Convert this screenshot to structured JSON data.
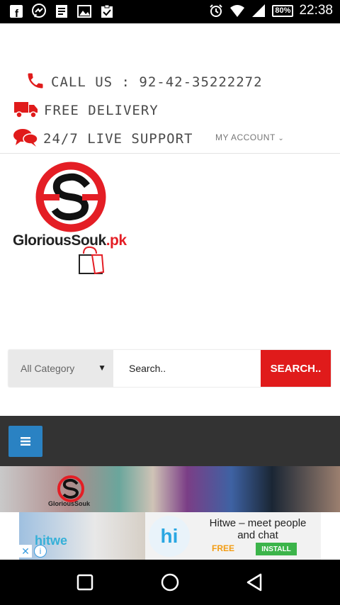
{
  "status_bar": {
    "time": "22:38",
    "battery": "80%",
    "notification_icons": [
      "facebook-icon",
      "messenger-icon",
      "document-icon",
      "image-icon",
      "clipboard-check-icon"
    ],
    "system_icons": [
      "alarm-icon",
      "wifi-icon",
      "signal-icon",
      "battery-icon"
    ]
  },
  "header": {
    "call_us": "CALL US : 92-42-35222272",
    "free_delivery": "FREE DELIVERY",
    "live_support": "24/7 LIVE SUPPORT",
    "my_account": "MY ACCOUNT"
  },
  "logo": {
    "text_main": "GloriousSouk",
    "text_suffix": ".pk"
  },
  "search": {
    "category_selected": "All Category",
    "placeholder": "Search..",
    "button_label": "SEARCH.."
  },
  "banner": {
    "logo_text": "GloriousSouk"
  },
  "ad": {
    "brand": "hitwe",
    "icon_text": "hi",
    "title": "Hitwe – meet people and chat",
    "price": "FREE",
    "install_label": "INSTALL"
  },
  "colors": {
    "accent_red": "#e01b1b",
    "menu_blue": "#2a82c3",
    "nav_dark": "#333333"
  }
}
